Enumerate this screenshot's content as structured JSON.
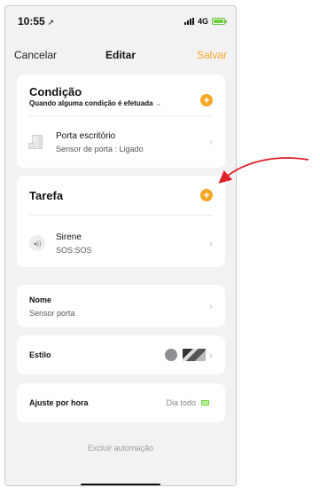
{
  "status_bar": {
    "time": "10:55",
    "network": "4G"
  },
  "nav": {
    "cancel": "Cancelar",
    "title": "Editar",
    "save": "Salvar"
  },
  "condition": {
    "title": "Condição",
    "subtitle": "Quando alguma condição é efetuada",
    "item": {
      "name": "Porta escritório",
      "detail": "Sensor de porta : Ligado"
    }
  },
  "task": {
    "title": "Tarefa",
    "item": {
      "name": "Sirene",
      "detail": "SOS:SOS"
    }
  },
  "name_row": {
    "label": "Nome",
    "value": "Sensor porta"
  },
  "style_row": {
    "label": "Estilo"
  },
  "schedule_row": {
    "label": "Ajuste por hora",
    "value": "Dia todo"
  },
  "delete": "Excluir automação",
  "colors": {
    "accent": "#f5a623",
    "annotation": "#e0202a"
  },
  "icons": {
    "add": "plus-circle-icon",
    "chevron": "chevron-right-icon",
    "door_sensor": "door-sensor-icon",
    "siren": "siren-icon"
  }
}
